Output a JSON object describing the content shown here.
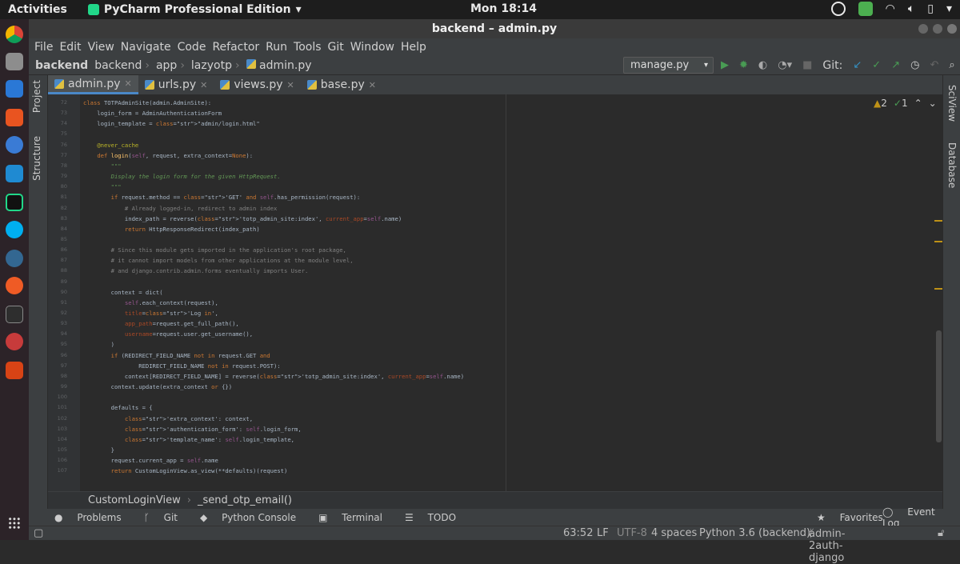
{
  "os": {
    "activities": "Activities",
    "app_name": "PyCharm Professional Edition",
    "clock": "Mon 18:14"
  },
  "window": {
    "title": "backend – admin.py"
  },
  "menu": [
    "File",
    "Edit",
    "View",
    "Navigate",
    "Code",
    "Refactor",
    "Run",
    "Tools",
    "Git",
    "Window",
    "Help"
  ],
  "breadcrumbs": [
    "backend",
    "backend",
    "app",
    "lazyotp",
    "admin.py"
  ],
  "run_config": "manage.py",
  "git_label": "Git:",
  "tabs": [
    "admin.py",
    "urls.py",
    "views.py",
    "base.py"
  ],
  "left_tool_tabs": [
    "Project",
    "Structure"
  ],
  "right_tool_tabs": [
    "SciView",
    "Database"
  ],
  "inspections": {
    "warnings": "2",
    "ok": "1"
  },
  "code_lines": [
    {
      "n": "72",
      "t": "class TOTPAdminSite(admin.AdminSite):"
    },
    {
      "n": "73",
      "t": "    login_form = AdminAuthenticationForm"
    },
    {
      "n": "74",
      "t": "    login_template = \"admin/login.html\""
    },
    {
      "n": "75",
      "t": ""
    },
    {
      "n": "76",
      "t": "    @never_cache"
    },
    {
      "n": "77",
      "t": "    def login(self, request, extra_context=None):"
    },
    {
      "n": "78",
      "t": "        \"\"\""
    },
    {
      "n": "79",
      "t": "        Display the login form for the given HttpRequest."
    },
    {
      "n": "80",
      "t": "        \"\"\""
    },
    {
      "n": "81",
      "t": "        if request.method == 'GET' and self.has_permission(request):"
    },
    {
      "n": "82",
      "t": "            # Already logged-in, redirect to admin index"
    },
    {
      "n": "83",
      "t": "            index_path = reverse('totp_admin_site:index', current_app=self.name)"
    },
    {
      "n": "84",
      "t": "            return HttpResponseRedirect(index_path)"
    },
    {
      "n": "85",
      "t": ""
    },
    {
      "n": "86",
      "t": "        # Since this module gets imported in the application's root package,"
    },
    {
      "n": "87",
      "t": "        # it cannot import models from other applications at the module level,"
    },
    {
      "n": "88",
      "t": "        # and django.contrib.admin.forms eventually imports User."
    },
    {
      "n": "89",
      "t": ""
    },
    {
      "n": "90",
      "t": "        context = dict("
    },
    {
      "n": "91",
      "t": "            self.each_context(request),"
    },
    {
      "n": "92",
      "t": "            title='Log in',"
    },
    {
      "n": "93",
      "t": "            app_path=request.get_full_path(),"
    },
    {
      "n": "94",
      "t": "            username=request.user.get_username(),"
    },
    {
      "n": "95",
      "t": "        )"
    },
    {
      "n": "96",
      "t": "        if (REDIRECT_FIELD_NAME not in request.GET and"
    },
    {
      "n": "97",
      "t": "                REDIRECT_FIELD_NAME not in request.POST):"
    },
    {
      "n": "98",
      "t": "            context[REDIRECT_FIELD_NAME] = reverse('totp_admin_site:index', current_app=self.name)"
    },
    {
      "n": "99",
      "t": "        context.update(extra_context or {})"
    },
    {
      "n": "100",
      "t": ""
    },
    {
      "n": "101",
      "t": "        defaults = {"
    },
    {
      "n": "102",
      "t": "            'extra_context': context,"
    },
    {
      "n": "103",
      "t": "            'authentication_form': self.login_form,"
    },
    {
      "n": "104",
      "t": "            'template_name': self.login_template,"
    },
    {
      "n": "105",
      "t": "        }"
    },
    {
      "n": "106",
      "t": "        request.current_app = self.name"
    },
    {
      "n": "107",
      "t": "        return CustomLoginView.as_view(**defaults)(request)"
    }
  ],
  "code_breadcrumbs": [
    "CustomLoginView",
    "_send_otp_email()"
  ],
  "tool_windows": [
    "Problems",
    "Git",
    "Python Console",
    "Terminal",
    "TODO"
  ],
  "tool_windows_right": [
    "Favorites",
    "Event Log"
  ],
  "status": {
    "position": "63:52",
    "line_sep": "LF",
    "encoding": "UTF-8",
    "indent": "4 spaces",
    "interpreter": "Python 3.6 (backend)",
    "branch": "admin-2auth-django"
  }
}
